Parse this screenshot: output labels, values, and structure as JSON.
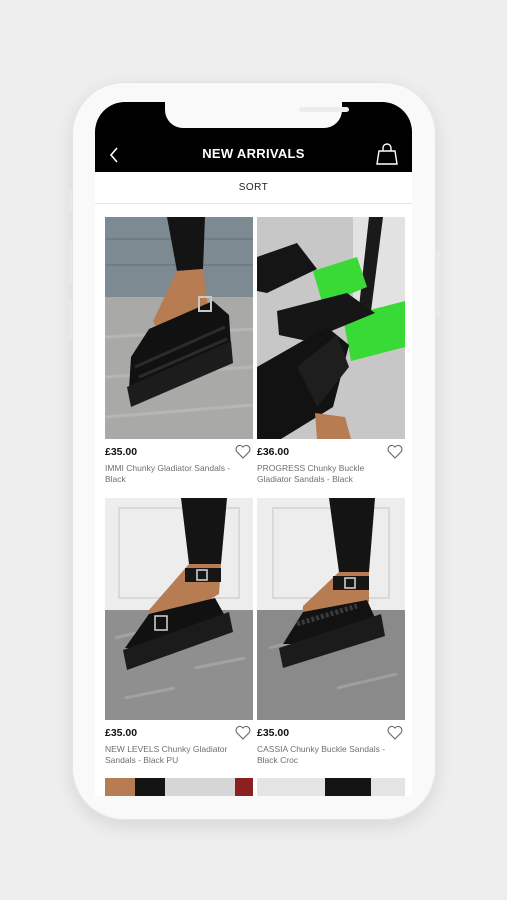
{
  "header": {
    "title": "NEW ARRIVALS",
    "back_icon": "chevron-left-icon",
    "bag_icon": "shopping-bag-icon"
  },
  "sort": {
    "label": "SORT"
  },
  "products": [
    {
      "price": "£35.00",
      "name": "IMMI Chunky Gladiator Sandals - Black"
    },
    {
      "price": "£36.00",
      "name": "PROGRESS Chunky Buckle Gladiator Sandals - Black"
    },
    {
      "price": "£35.00",
      "name": "NEW LEVELS Chunky Gladiator Sandals - Black PU"
    },
    {
      "price": "£35.00",
      "name": "CASSIA Chunky Buckle Sandals - Black Croc"
    }
  ],
  "colors": {
    "header_bg": "#000000",
    "accent_green": "#39d936",
    "background": "#eeeeee"
  }
}
